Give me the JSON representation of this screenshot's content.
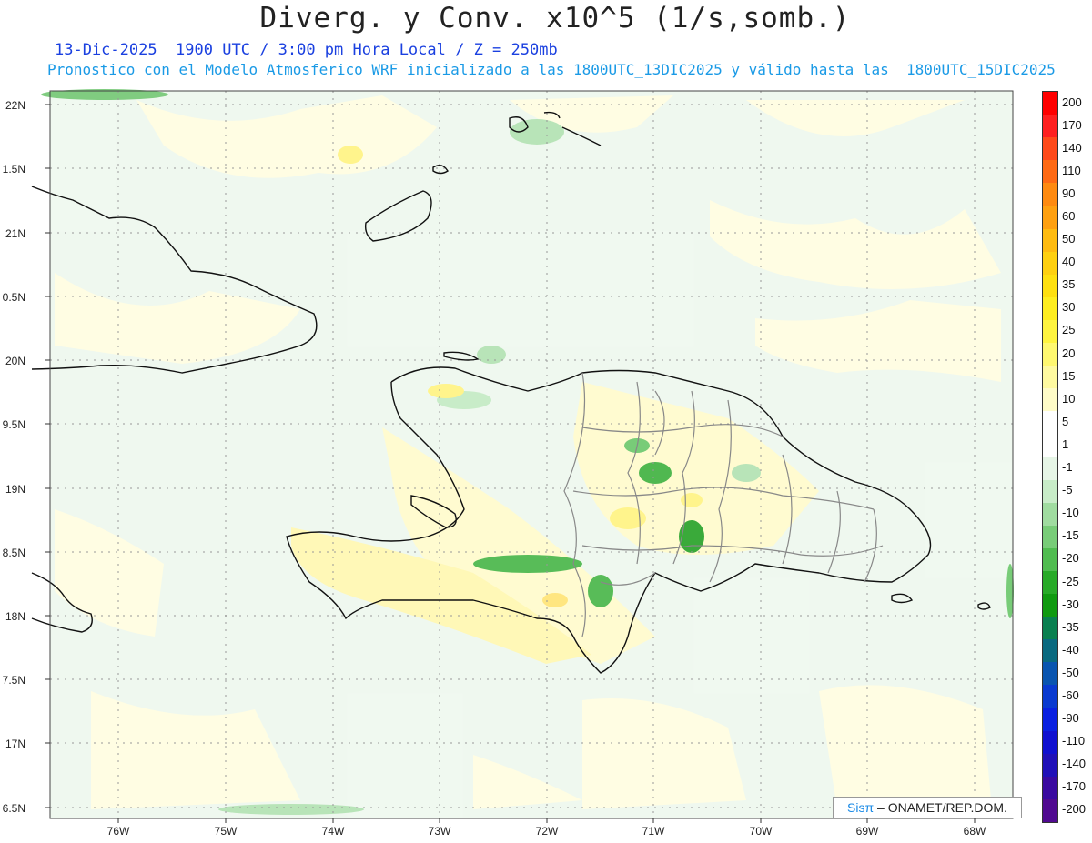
{
  "title": "Diverg. y Conv. x10^5 (1/s,somb.)",
  "subtitle_line1": "13-Dic-2025  1900 UTC / 3:00 pm Hora Local / Z = 250mb",
  "subtitle_line2": "Pronostico con el Modelo Atmosferico WRF inicializado a las 1800UTC_13DIC2025 y válido hasta las  1800UTC_15DIC2025",
  "lat_labels": [
    "22N",
    "1.5N",
    "21N",
    "0.5N",
    "20N",
    "9.5N",
    "19N",
    "8.5N",
    "18N",
    "7.5N",
    "17N",
    "6.5N"
  ],
  "lon_labels": [
    "76W",
    "75W",
    "74W",
    "73W",
    "72W",
    "71W",
    "70W",
    "69W",
    "68W"
  ],
  "colorbar": {
    "labels": [
      "200",
      "170",
      "140",
      "110",
      "90",
      "60",
      "50",
      "40",
      "35",
      "30",
      "25",
      "20",
      "15",
      "10",
      "5",
      "1",
      "-1",
      "-5",
      "-10",
      "-15",
      "-20",
      "-25",
      "-30",
      "-35",
      "-40",
      "-50",
      "-60",
      "-90",
      "-110",
      "-140",
      "-170",
      "-200"
    ],
    "colors": [
      "#ff0000",
      "#ff2020",
      "#ff4a1a",
      "#ff6a14",
      "#ff8a10",
      "#ffa010",
      "#ffbb10",
      "#ffd010",
      "#ffe010",
      "#ffee20",
      "#fff440",
      "#fff870",
      "#fffaa0",
      "#fffcc8",
      "#ffffff",
      "#ffffff",
      "#e6f5e6",
      "#c8ecc8",
      "#a0dca0",
      "#78cc78",
      "#50bc50",
      "#28aa28",
      "#109a10",
      "#0a8050",
      "#0a6a80",
      "#0a55b0",
      "#0a3ad0",
      "#0a20e0",
      "#1010d0",
      "#2010b8",
      "#3a0aa0",
      "#500a90"
    ]
  },
  "credit": {
    "sis": "Sisπ",
    "org": " – ONAMET/REP.DOM."
  }
}
